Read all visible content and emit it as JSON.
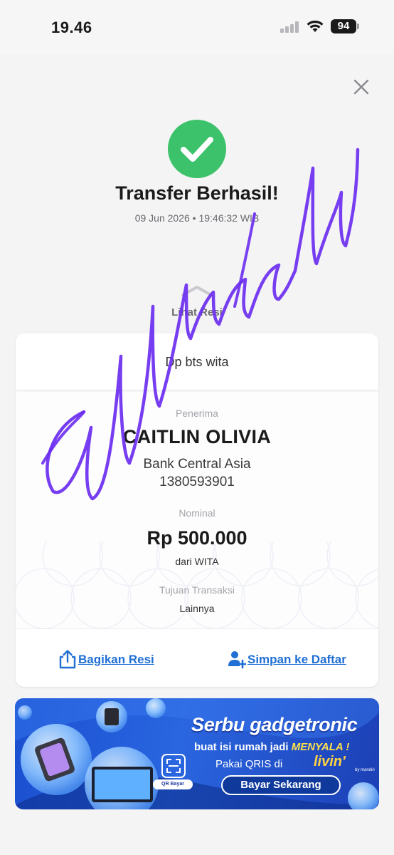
{
  "status_bar": {
    "time": "19.46",
    "battery": "94"
  },
  "header": {
    "title": "Transfer Berhasil!",
    "datetime": "09 Jun 2026 • 19:46:32 WIB",
    "view_receipt_label": "Lihat Resi"
  },
  "receipt": {
    "note": "Dp bts wita",
    "recipient_label": "Penerima",
    "recipient_name": "CAITLIN OLIVIA",
    "bank_name": "Bank Central Asia",
    "account_number": "1380593901",
    "amount_label": "Nominal",
    "amount": "Rp 500.000",
    "source": "dari WITA",
    "purpose_label": "Tujuan Transaksi",
    "purpose": "Lainnya"
  },
  "actions": {
    "share_label": "Bagikan Resi",
    "save_label": "Simpan ke Daftar"
  },
  "banner": {
    "headline": "Serbu gadgetronic",
    "line1_prefix": "buat isi rumah jadi ",
    "line1_emphasis": "MENYALA !",
    "line2": "Pakai QRIS di",
    "brand": "livin'",
    "brand_sub": "by mandiri",
    "qr_label": "QR Bayar",
    "cta": "Bayar Sekarang"
  },
  "colors": {
    "success": "#3cc26a",
    "link": "#1f6fd4",
    "watermark": "#6a2cf0",
    "banner": "#1a4fd0"
  }
}
